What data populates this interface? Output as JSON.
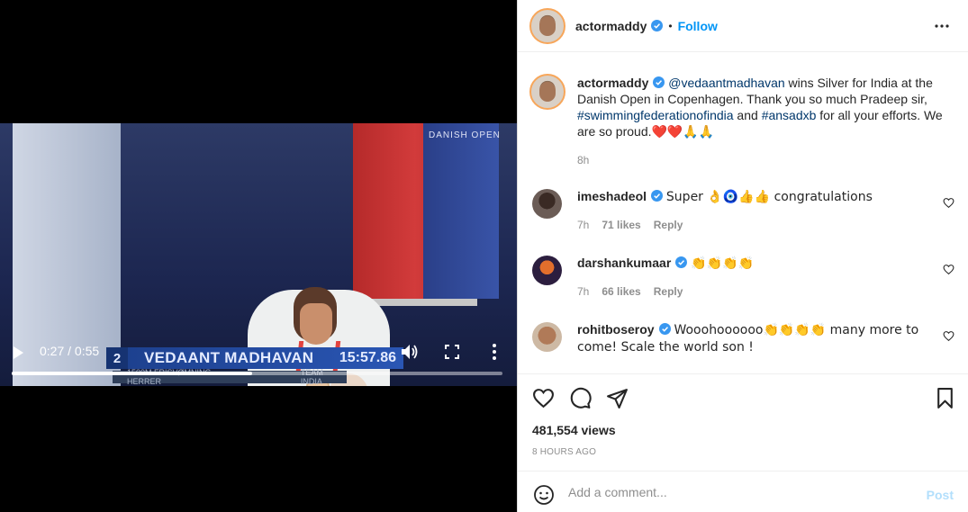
{
  "video": {
    "overlay_logo": "DANISH OPEN",
    "rank": "2",
    "athlete_name": "VEDAANT MADHAVAN",
    "result_time": "15:57.86",
    "event_line": "1500M FRISVØMNING HERRER",
    "team_line": "TEAM INDIA",
    "time_display": "0:27 / 0:55",
    "progress": 0.49
  },
  "header": {
    "username": "actormaddy",
    "separator": "•",
    "follow_label": "Follow"
  },
  "caption": {
    "username": "actormaddy",
    "mention": "@vedaantmadhavan",
    "text_1": " wins Silver for India at the Danish Open in Copenhagen. Thank you so much Pradeep sir, ",
    "hashtag_1": "#swimmingfederationofindia",
    "text_2": " and ",
    "hashtag_2": "#ansadxb",
    "text_3": " for all your efforts. We are so proud.",
    "emojis": "❤️❤️🙏🙏",
    "time": "8h"
  },
  "comments": [
    {
      "username": "imeshadeol",
      "text": "Super 👌🧿👍👍 congratulations",
      "time": "7h",
      "likes": "71 likes",
      "reply": "Reply"
    },
    {
      "username": "darshankumaar",
      "text": "👏👏👏👏",
      "time": "7h",
      "likes": "66 likes",
      "reply": "Reply"
    },
    {
      "username": "rohitboseroy",
      "text": "Wooohoooooo👏👏👏👏 many more to come! Scale the world son !"
    }
  ],
  "stats": {
    "views": "481,554 views",
    "posted": "8 HOURS AGO"
  },
  "composer": {
    "placeholder": "Add a comment...",
    "post_label": "Post"
  },
  "colors": {
    "accent": "#0095f6",
    "verified": "#3897f0",
    "muted": "#8e8e8e",
    "post_disabled": "#b2dffc"
  }
}
